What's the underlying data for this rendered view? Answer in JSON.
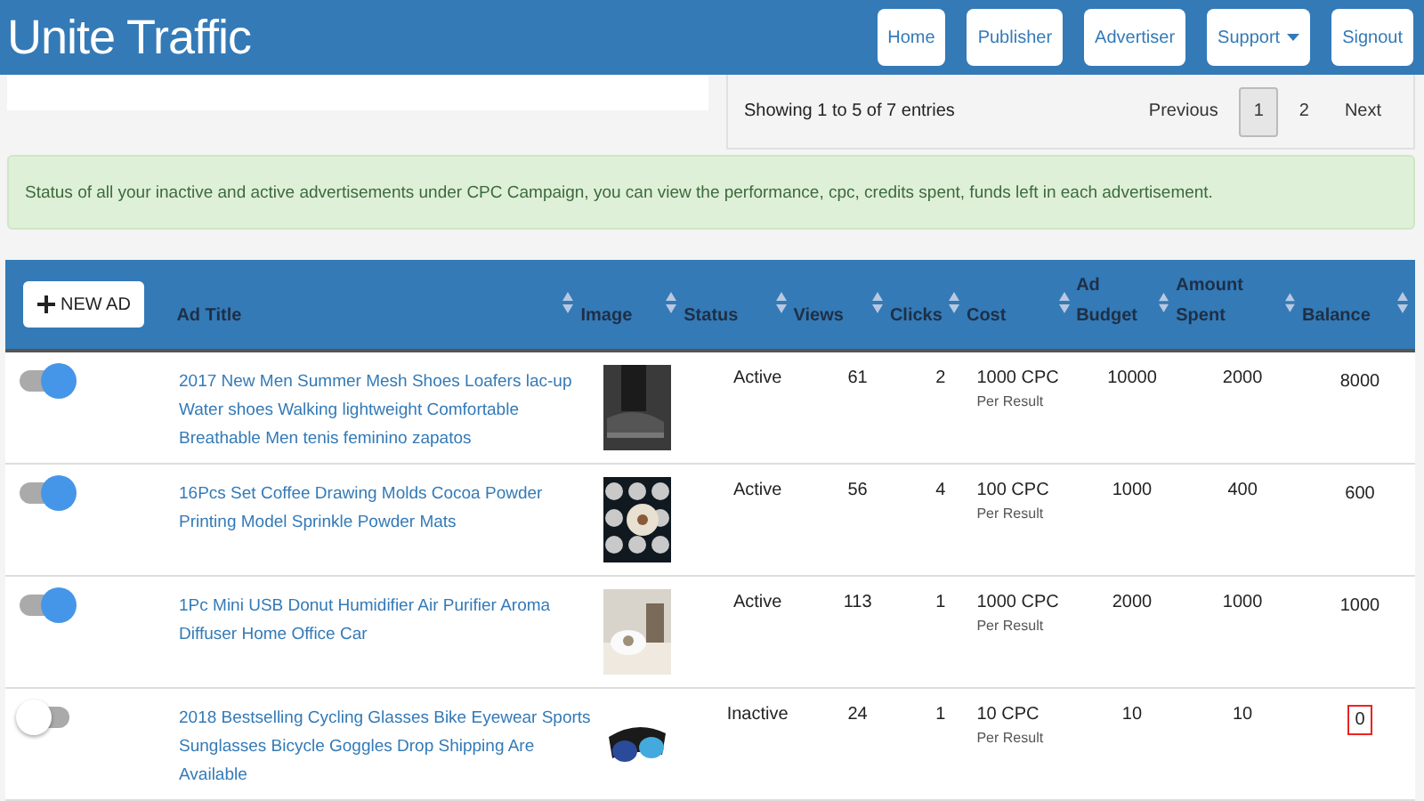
{
  "brand": "Unite Traffic",
  "nav": [
    {
      "label": "Home",
      "dropdown": false
    },
    {
      "label": "Publisher",
      "dropdown": false
    },
    {
      "label": "Advertiser",
      "dropdown": false
    },
    {
      "label": "Support",
      "dropdown": true
    },
    {
      "label": "Signout",
      "dropdown": false
    }
  ],
  "table_info": "Showing 1 to 5 of 7 entries",
  "pagination": [
    {
      "label": "Previous",
      "selected": false
    },
    {
      "label": "1",
      "selected": true
    },
    {
      "label": "2",
      "selected": false
    },
    {
      "label": "Next",
      "selected": false
    }
  ],
  "alert": "Status of all your inactive and active advertisements under CPC Campaign, you can view the performance, cpc, credits spent, funds left in each advertisement.",
  "new_ad_button": "NEW AD",
  "columns": [
    "Ad Title",
    "Image",
    "Status",
    "Views",
    "Clicks",
    "Cost",
    "Ad Budget",
    "Amount Spent",
    "Balance"
  ],
  "rows": [
    {
      "on": true,
      "title": "2017 New Men Summer Mesh Shoes Loafers lac-up Water shoes Walking lightweight Comfortable Breathable Men tenis feminino zapatos",
      "status": "Active",
      "views": "61",
      "clicks": "2",
      "cost": "1000 CPC",
      "cost_note": "Per Result",
      "budget": "10000",
      "spent": "2000",
      "balance": "8000",
      "balance_highlighted": false
    },
    {
      "on": true,
      "title": "16Pcs Set Coffee Drawing Molds Cocoa Powder Printing Model Sprinkle Powder Mats",
      "status": "Active",
      "views": "56",
      "clicks": "4",
      "cost": "100 CPC",
      "cost_note": "Per Result",
      "budget": "1000",
      "spent": "400",
      "balance": "600",
      "balance_highlighted": false
    },
    {
      "on": true,
      "title": "1Pc Mini USB Donut Humidifier Air Purifier Aroma Diffuser Home Office Car",
      "status": "Active",
      "views": "113",
      "clicks": "1",
      "cost": "1000 CPC",
      "cost_note": "Per Result",
      "budget": "2000",
      "spent": "1000",
      "balance": "1000",
      "balance_highlighted": false
    },
    {
      "on": false,
      "title": "2018 Bestselling Cycling Glasses Bike Eyewear Sports Sunglasses Bicycle Goggles Drop Shipping Are Available",
      "status": "Inactive",
      "views": "24",
      "clicks": "1",
      "cost": "10 CPC",
      "cost_note": "Per Result",
      "budget": "10",
      "spent": "10",
      "balance": "0",
      "balance_highlighted": true
    }
  ]
}
